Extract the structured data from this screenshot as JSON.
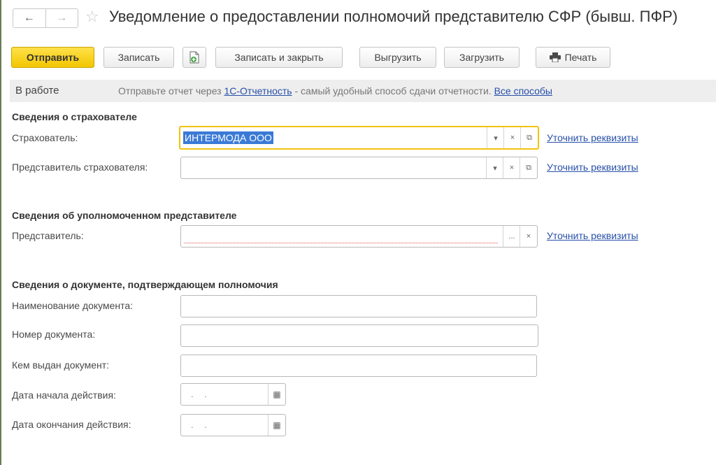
{
  "window": {
    "title": "Уведомление о предоставлении полномочий представителю СФР (бывш. ПФР)",
    "nav": {
      "back": "←",
      "forward": "→"
    }
  },
  "toolbar": {
    "send": "Отправить",
    "save": "Записать",
    "save_close": "Записать и закрыть",
    "export": "Выгрузить",
    "import": "Загрузить",
    "print": "Печать"
  },
  "status": {
    "state": "В работе",
    "msg_prefix": "Отправьте отчет через ",
    "msg_link": "1С-Отчетность",
    "msg_suffix": " - самый удобный способ сдачи отчетности. ",
    "all_link": "Все способы"
  },
  "insurer": {
    "section_title": "Сведения о страхователе",
    "insurer_label": "Страхователь:",
    "insurer_value": "ИНТЕРМОДА ООО",
    "rep_label": "Представитель страхователя:",
    "rep_value": "",
    "clarify_link": "Уточнить реквизиты"
  },
  "representative": {
    "section_title": "Сведения об уполномоченном представителе",
    "label": "Представитель:",
    "value": "",
    "clarify_link": "Уточнить реквизиты"
  },
  "document": {
    "section_title": "Сведения о документе, подтверждающем полномочия",
    "name_label": "Наименование документа:",
    "number_label": "Номер документа:",
    "issued_label": "Кем выдан документ:",
    "start_label": "Дата начала действия:",
    "end_label": "Дата окончания действия:",
    "start_value": ". .",
    "end_value": ". ."
  },
  "icons": {
    "dropdown": "▾",
    "clear": "×",
    "open": "⧉",
    "select": "...",
    "calendar": "▦"
  }
}
